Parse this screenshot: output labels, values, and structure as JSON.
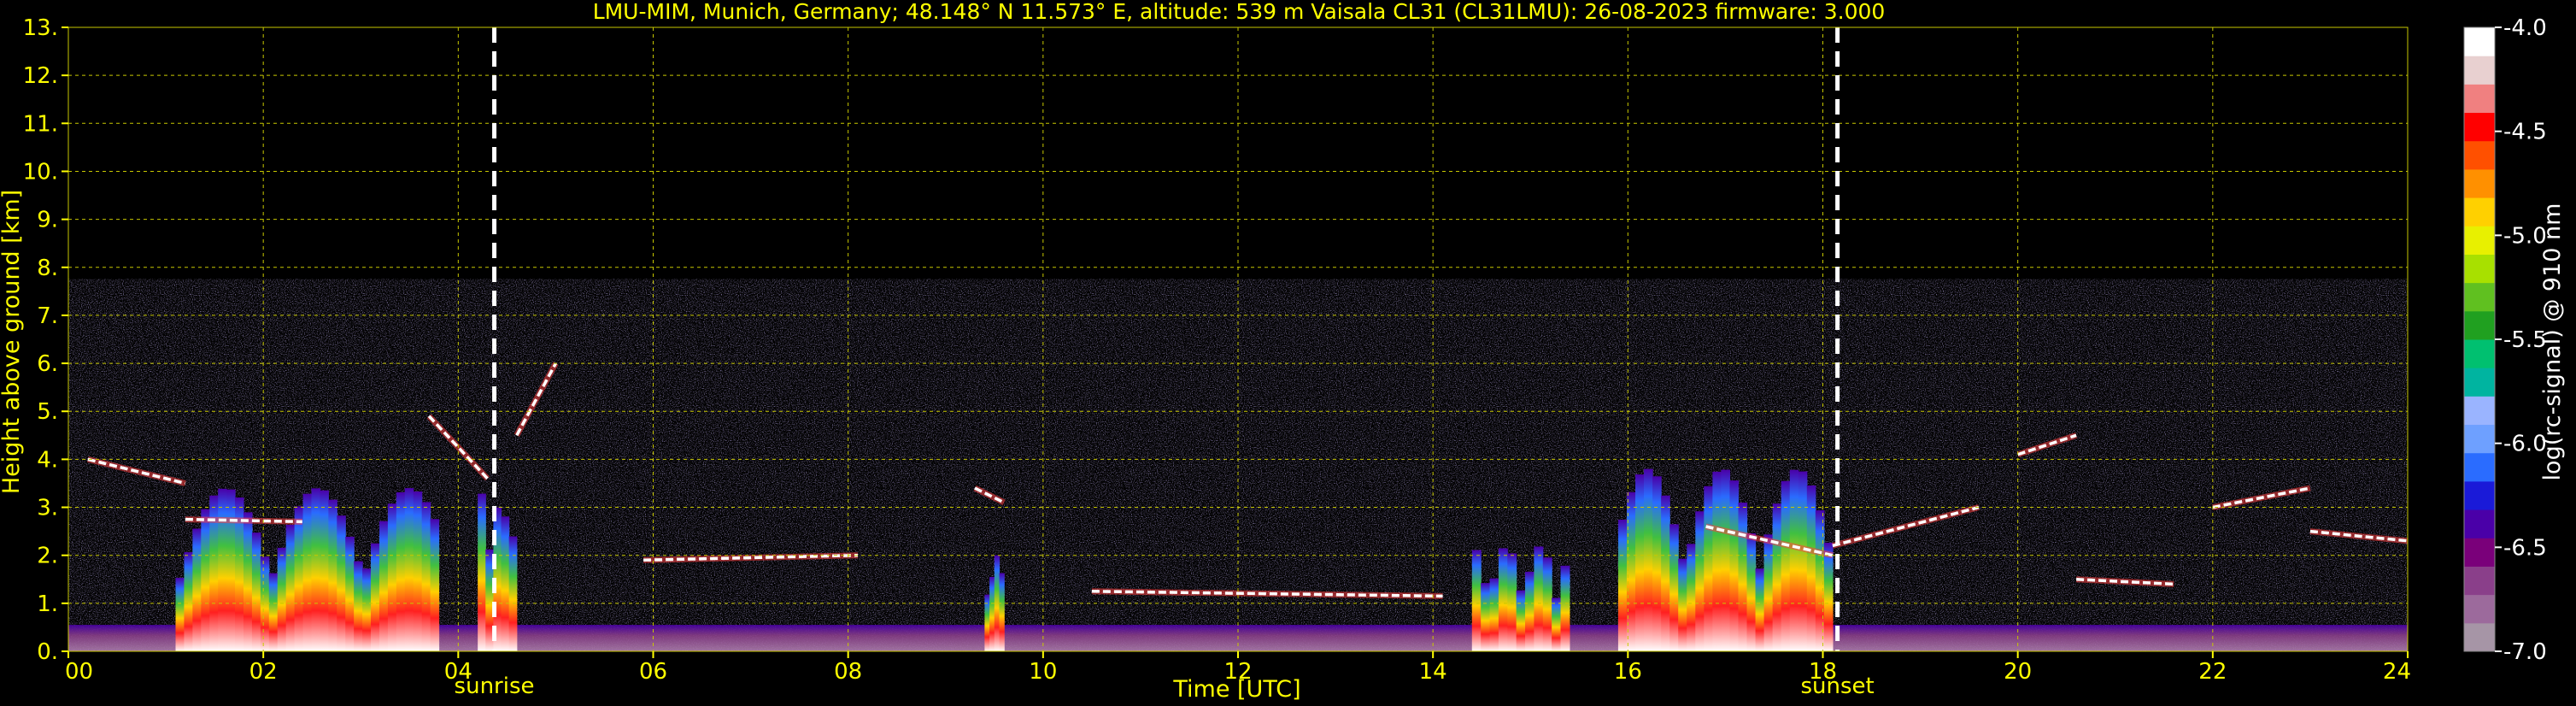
{
  "chart_data": {
    "type": "heatmap",
    "title": "LMU-MIM, Munich, Germany; 48.148° N 11.573° E, altitude: 539 m    Vaisala CL31 (CL31LMU): 26-08-2023    firmware: 3.000",
    "xlabel": "Time [UTC]",
    "ylabel": "Height above ground [km]",
    "xlim": [
      0,
      24
    ],
    "ylim": [
      0,
      13
    ],
    "xticks": [
      "00",
      "02",
      "04",
      "06",
      "08",
      "10",
      "12",
      "14",
      "16",
      "18",
      "20",
      "22",
      "24"
    ],
    "yticks": [
      "0.",
      "1.",
      "2.",
      "3.",
      "4.",
      "5.",
      "6.",
      "7.",
      "8.",
      "9.",
      "10.",
      "11.",
      "12.",
      "13."
    ],
    "grid": true,
    "colorbar": {
      "label": "log(rc-signal) @ 910 nm",
      "range": [
        -7.0,
        -4.0
      ],
      "ticks": [
        "-4.0",
        "-4.5",
        "-5.0",
        "-5.5",
        "-6.0",
        "-6.5",
        "-7.0"
      ]
    },
    "events": [
      {
        "label": "sunrise",
        "time_utc_hours": 4.37
      },
      {
        "label": "sunset",
        "time_utc_hours": 18.15
      }
    ],
    "signal_top_km": 7.75,
    "cloud_layers": [
      {
        "t_start": 0.2,
        "t_end": 1.2,
        "h_start": 4.0,
        "h_end": 3.5
      },
      {
        "t_start": 1.2,
        "t_end": 2.4,
        "h_start": 2.75,
        "h_end": 2.7
      },
      {
        "t_start": 3.7,
        "t_end": 4.3,
        "h_start": 4.9,
        "h_end": 3.6
      },
      {
        "t_start": 4.6,
        "t_end": 5.0,
        "h_start": 4.5,
        "h_end": 6.0
      },
      {
        "t_start": 5.9,
        "t_end": 8.1,
        "h_start": 1.9,
        "h_end": 2.0
      },
      {
        "t_start": 9.3,
        "t_end": 9.6,
        "h_start": 3.4,
        "h_end": 3.1
      },
      {
        "t_start": 10.5,
        "t_end": 14.1,
        "h_start": 1.25,
        "h_end": 1.15
      },
      {
        "t_start": 16.8,
        "t_end": 18.1,
        "h_start": 2.6,
        "h_end": 2.0
      },
      {
        "t_start": 18.1,
        "t_end": 19.6,
        "h_start": 2.2,
        "h_end": 3.0
      },
      {
        "t_start": 20.0,
        "t_end": 20.6,
        "h_start": 4.1,
        "h_end": 4.5
      },
      {
        "t_start": 20.6,
        "t_end": 21.6,
        "h_start": 1.5,
        "h_end": 1.4
      },
      {
        "t_start": 22.0,
        "t_end": 23.0,
        "h_start": 3.0,
        "h_end": 3.4
      },
      {
        "t_start": 23.0,
        "t_end": 24.0,
        "h_start": 2.5,
        "h_end": 2.3
      }
    ],
    "boundary_layer_plumes": [
      {
        "t_start": 1.1,
        "t_end": 3.8,
        "h_top": 3.4
      },
      {
        "t_start": 4.2,
        "t_end": 4.6,
        "h_top": 3.3
      },
      {
        "t_start": 9.4,
        "t_end": 9.6,
        "h_top": 2.0
      },
      {
        "t_start": 14.4,
        "t_end": 15.4,
        "h_top": 2.2
      },
      {
        "t_start": 15.9,
        "t_end": 18.1,
        "h_top": 3.8
      }
    ]
  },
  "colors": {
    "text": "#ffff00",
    "grid": "#c8c800",
    "event_line": "#ffffff",
    "colormap": [
      "#a695a6",
      "#9c6a9c",
      "#8a3f8a",
      "#7a007a",
      "#4a00a8",
      "#1a1ad8",
      "#2a6cff",
      "#6ea0ff",
      "#9ab4ff",
      "#00b4a0",
      "#00c070",
      "#20a020",
      "#60c020",
      "#a8e000",
      "#e8f000",
      "#ffd000",
      "#ff9000",
      "#ff5000",
      "#ff0000",
      "#f08080",
      "#e8d0d0",
      "#ffffff"
    ]
  }
}
